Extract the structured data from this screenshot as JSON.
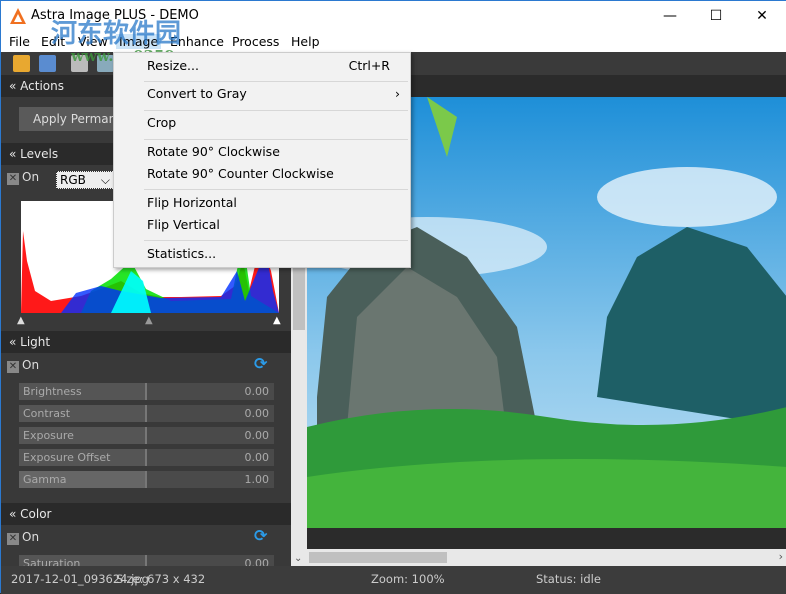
{
  "window": {
    "title": "Astra Image PLUS - DEMO",
    "minimize": "—",
    "maximize": "☐",
    "close": "✕"
  },
  "menubar": [
    "File",
    "Edit",
    "View",
    "Image",
    "Enhance",
    "Process",
    "Help"
  ],
  "watermark": {
    "text": "河东软件园",
    "url": "www.pc0359.cn"
  },
  "image_menu": {
    "items": [
      {
        "label": "Resize...",
        "shortcut": "Ctrl+R"
      },
      {
        "label": "Convert to Gray",
        "submenu": "›"
      },
      {
        "label": "Crop"
      },
      {
        "label": "Rotate 90° Clockwise"
      },
      {
        "label": "Rotate 90° Counter Clockwise"
      },
      {
        "label": "Flip Horizontal"
      },
      {
        "label": "Flip Vertical"
      },
      {
        "label": "Statistics..."
      }
    ]
  },
  "panels": {
    "actions": {
      "title": "Actions",
      "apply_button": "Apply Permanently"
    },
    "levels": {
      "title": "Levels",
      "on": "On",
      "channel": "RGB"
    },
    "light": {
      "title": "Light",
      "on": "On",
      "sliders": [
        {
          "label": "Brightness",
          "value": "0.00"
        },
        {
          "label": "Contrast",
          "value": "0.00"
        },
        {
          "label": "Exposure",
          "value": "0.00"
        },
        {
          "label": "Exposure Offset",
          "value": "0.00"
        },
        {
          "label": "Gamma",
          "value": "1.00"
        }
      ]
    },
    "color": {
      "title": "Color",
      "on": "On",
      "sliders": [
        {
          "label": "Saturation",
          "value": "0.00"
        }
      ]
    }
  },
  "status": {
    "file": "2017-12-01_093624.jpg",
    "size": "Size: 673 x 432",
    "zoom": "Zoom: 100%",
    "state": "Status: idle"
  },
  "colors": {
    "accent": "#2b9be8",
    "panel": "#393939"
  }
}
